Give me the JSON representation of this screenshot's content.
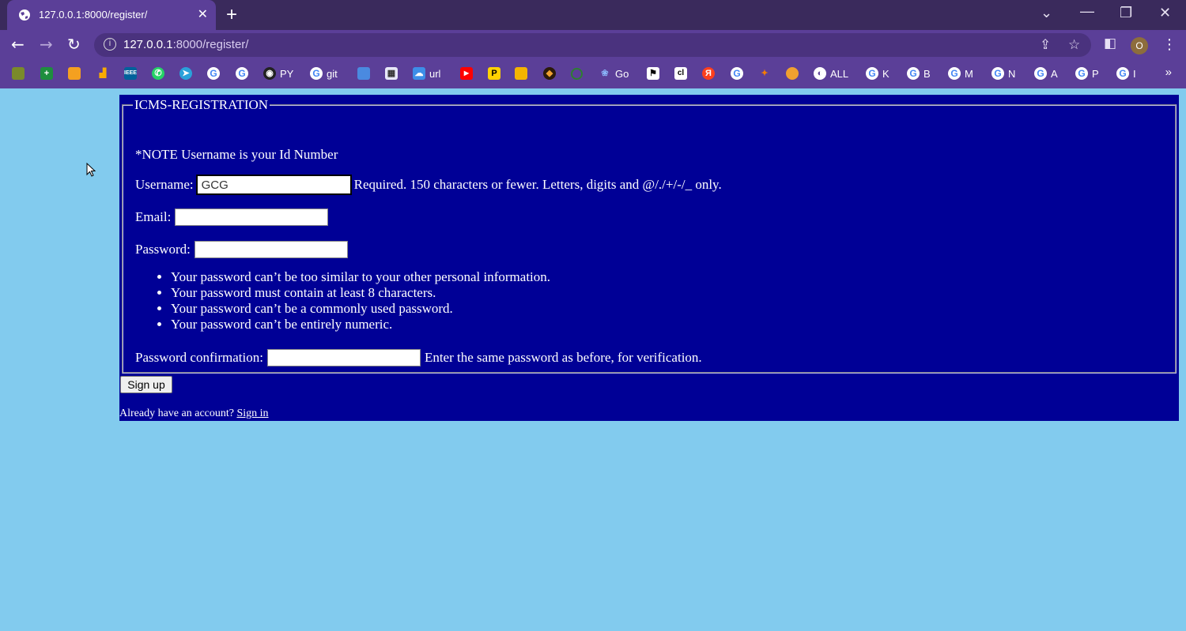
{
  "browser": {
    "tab_title": "127.0.0.1:8000/register/",
    "url_host": "127.0.0.1",
    "url_path": ":8000/register/",
    "profile_initial": "O",
    "bookmarks": [
      {
        "label": "",
        "icon": "bookmark-icon-1"
      },
      {
        "label": "",
        "icon": "bookmark-icon-2"
      },
      {
        "label": "",
        "icon": "bookmark-icon-3"
      },
      {
        "label": "",
        "icon": "bookmark-icon-4"
      },
      {
        "label": "IEEE",
        "icon": "ieee-icon"
      },
      {
        "label": "",
        "icon": "whatsapp-icon"
      },
      {
        "label": "",
        "icon": "telegram-icon"
      },
      {
        "label": "",
        "icon": "google-icon"
      },
      {
        "label": "",
        "icon": "google-icon"
      },
      {
        "label": "PY",
        "icon": "github-icon"
      },
      {
        "label": "git",
        "icon": "google-icon"
      },
      {
        "label": "url",
        "icon": "cloud-icon"
      },
      {
        "label": "Go",
        "icon": "go-icon"
      },
      {
        "label": "ALL",
        "icon": "globe-icon"
      },
      {
        "label": "K",
        "icon": "google-icon"
      },
      {
        "label": "B",
        "icon": "google-icon"
      },
      {
        "label": "M",
        "icon": "google-icon"
      },
      {
        "label": "N",
        "icon": "google-icon"
      },
      {
        "label": "A",
        "icon": "google-icon"
      },
      {
        "label": "P",
        "icon": "google-icon"
      },
      {
        "label": "I",
        "icon": "google-icon"
      }
    ]
  },
  "form": {
    "legend": "ICMS-REGISTRATION",
    "note": "*NOTE Username is your Id Number",
    "username_label": "Username:",
    "username_value": "GCG",
    "username_help": "Required. 150 characters or fewer. Letters, digits and @/./+/-/_ only.",
    "email_label": "Email:",
    "password_label": "Password:",
    "password_rules": [
      "Your password can’t be too similar to your other personal information.",
      "Your password must contain at least 8 characters.",
      "Your password can’t be a commonly used password.",
      "Your password can’t be entirely numeric."
    ],
    "confirm_label": "Password confirmation:",
    "confirm_help": "Enter the same password as before, for verification.",
    "signup_label": "Sign up",
    "already_text": "Already have an account?",
    "signin_link": "Sign in"
  },
  "colors": {
    "page_bg": "#82cbee",
    "panel_bg": "#000096",
    "chrome_bg": "#5b3f98"
  }
}
